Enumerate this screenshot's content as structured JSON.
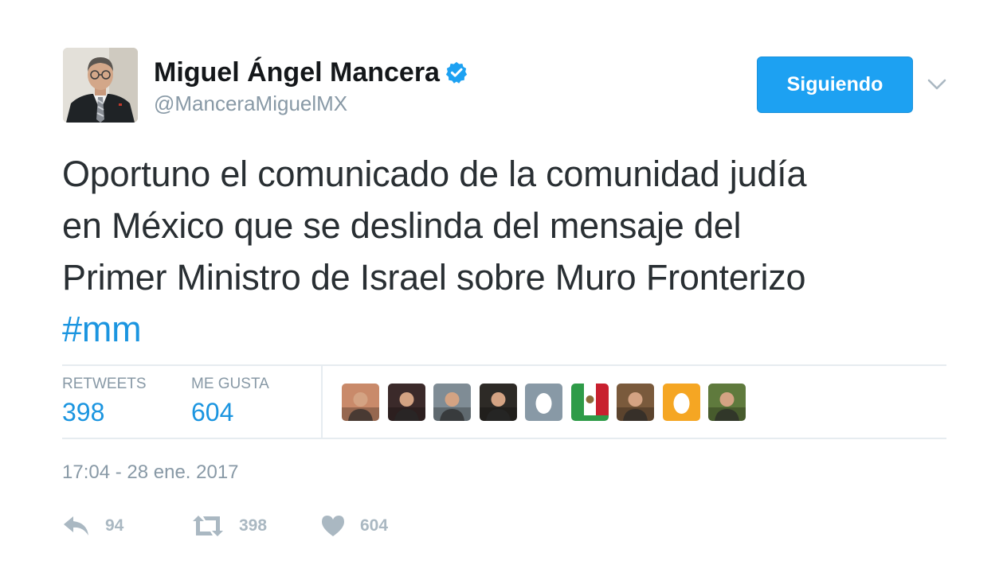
{
  "tweet": {
    "author": {
      "name": "Miguel Ángel Mancera",
      "handle": "@ManceraMiguelMX",
      "verified": true,
      "avatar": "profile-photo-man-in-suit"
    },
    "follow_button_label": "Siguiendo",
    "more_menu_icon": "chevron-down-icon",
    "text_lines": [
      "Oportuno el comunicado de la comunidad judía",
      "en México que se deslinda del mensaje del",
      "Primer Ministro de Israel sobre Muro Fronterizo"
    ],
    "hashtag": "#mm",
    "stats": {
      "retweets_label": "RETWEETS",
      "retweets_value": "398",
      "likes_label": "ME GUSTA",
      "likes_value": "604"
    },
    "likers": [
      {
        "icon": "liker-avatar-photo",
        "color": "#c98a6a"
      },
      {
        "icon": "liker-avatar-photo",
        "color": "#3b2a2a"
      },
      {
        "icon": "liker-avatar-photo",
        "color": "#7f8c95"
      },
      {
        "icon": "liker-avatar-photo",
        "color": "#2d2a26"
      },
      {
        "icon": "default-egg-avatar",
        "color": "#8899a6"
      },
      {
        "icon": "liker-avatar-flag",
        "color": "#2e9b48"
      },
      {
        "icon": "liker-avatar-photo",
        "color": "#7a5a3c"
      },
      {
        "icon": "default-egg-avatar",
        "color": "#f5a623"
      },
      {
        "icon": "liker-avatar-photo",
        "color": "#5f7a3d"
      }
    ],
    "timestamp": "17:04 - 28 ene. 2017",
    "actions": {
      "reply_count": "94",
      "retweet_count": "398",
      "like_count": "604"
    }
  },
  "colors": {
    "accent": "#1da1f2",
    "link": "#1b95e0",
    "muted": "#8899a6",
    "action_gray": "#aab8c2"
  }
}
